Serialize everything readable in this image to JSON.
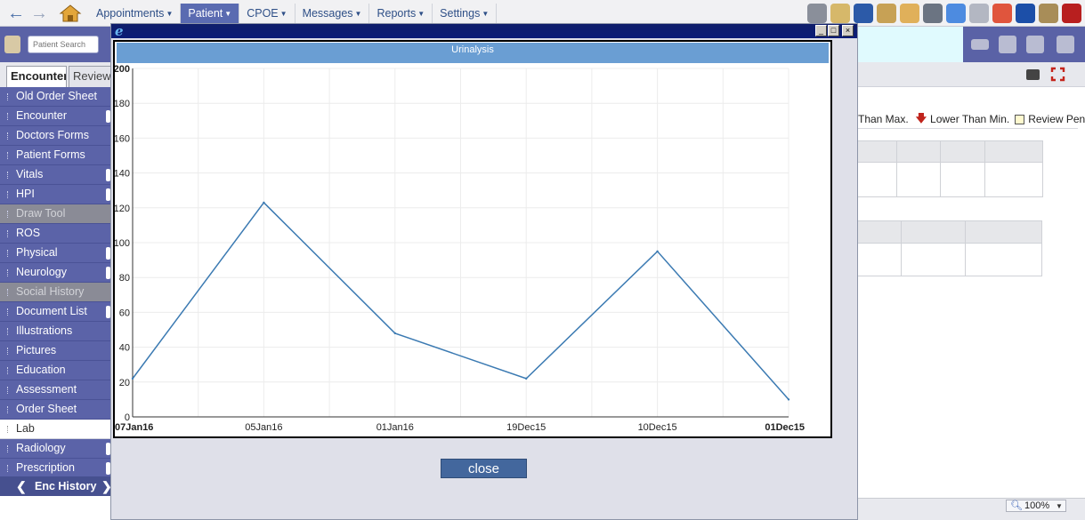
{
  "menu": [
    {
      "label": "Appointments",
      "active": false
    },
    {
      "label": "Patient",
      "active": true
    },
    {
      "label": "CPOE",
      "active": false
    },
    {
      "label": "Messages",
      "active": false
    },
    {
      "label": "Reports",
      "active": false
    },
    {
      "label": "Settings",
      "active": false
    }
  ],
  "toolbar_icons": [
    {
      "name": "dashboard-icon",
      "color": "#8a8f9a"
    },
    {
      "name": "notepad-pen-icon",
      "color": "#d6b86a"
    },
    {
      "name": "bill-icon",
      "color": "#2c5aa8"
    },
    {
      "name": "certificate-icon",
      "color": "#c7a155"
    },
    {
      "name": "user-icon",
      "color": "#e0b05a"
    },
    {
      "name": "stethoscope-icon",
      "color": "#6b7482"
    },
    {
      "name": "download-tray-icon",
      "color": "#4d8be0"
    },
    {
      "name": "copy-pages-icon",
      "color": "#b3b7c2"
    },
    {
      "name": "lifebuoy-icon",
      "color": "#e0553d"
    },
    {
      "name": "info-icon",
      "color": "#1c4fa8"
    },
    {
      "name": "padlock-icon",
      "color": "#a88d58"
    },
    {
      "name": "power-icon",
      "color": "#b81f1f"
    }
  ],
  "patient_search": {
    "placeholder": "Patient Search"
  },
  "encounter_tabs": [
    {
      "label": "Encounter"
    },
    {
      "label": "Review"
    }
  ],
  "sidebar_items": [
    {
      "label": "Old Order Sheet",
      "state": "normal",
      "flag": false
    },
    {
      "label": "Encounter",
      "state": "normal",
      "flag": true
    },
    {
      "label": "Doctors Forms",
      "state": "normal",
      "flag": false
    },
    {
      "label": "Patient Forms",
      "state": "normal",
      "flag": false
    },
    {
      "label": "Vitals",
      "state": "normal",
      "flag": true
    },
    {
      "label": "HPI",
      "state": "normal",
      "flag": true
    },
    {
      "label": "Draw Tool",
      "state": "disabled",
      "flag": false
    },
    {
      "label": "ROS",
      "state": "normal",
      "flag": false
    },
    {
      "label": "Physical",
      "state": "normal",
      "flag": true
    },
    {
      "label": "Neurology",
      "state": "normal",
      "flag": true
    },
    {
      "label": "Social History",
      "state": "disabled",
      "flag": false
    },
    {
      "label": "Document List",
      "state": "normal",
      "flag": true
    },
    {
      "label": "Illustrations",
      "state": "normal",
      "flag": false
    },
    {
      "label": "Pictures",
      "state": "normal",
      "flag": false
    },
    {
      "label": "Education",
      "state": "normal",
      "flag": false
    },
    {
      "label": "Assessment",
      "state": "normal",
      "flag": false
    },
    {
      "label": "Order Sheet",
      "state": "normal",
      "flag": false
    },
    {
      "label": "Lab",
      "state": "selected",
      "flag": false
    },
    {
      "label": "Radiology",
      "state": "normal",
      "flag": true
    },
    {
      "label": "Prescription",
      "state": "normal",
      "flag": true
    }
  ],
  "enc_history": {
    "label": "Enc History",
    "left_arrow": "❮",
    "right_arrow": "❯"
  },
  "legend": {
    "higher_than_max": "Than Max.",
    "lower_than_min": "Lower Than Min.",
    "review_pending": "Review Pending"
  },
  "popup": {
    "minimize": "_",
    "maximize": "□",
    "close_glyph": "×",
    "close_button": "close"
  },
  "chart_data": {
    "type": "line",
    "title": "Urinalysis",
    "x": [
      "07Jan16",
      "05Jan16",
      "01Jan16",
      "19Dec15",
      "10Dec15",
      "01Dec15"
    ],
    "series": [
      {
        "values": [
          22,
          123,
          48,
          22,
          95,
          10
        ],
        "color": "#3b7ab2"
      }
    ],
    "ylim": [
      0,
      200
    ],
    "yticks": [
      0,
      20,
      40,
      60,
      80,
      100,
      120,
      140,
      160,
      180,
      200
    ],
    "grid": true,
    "xlabel": "",
    "ylabel": ""
  },
  "zoom": {
    "label": "100%"
  }
}
